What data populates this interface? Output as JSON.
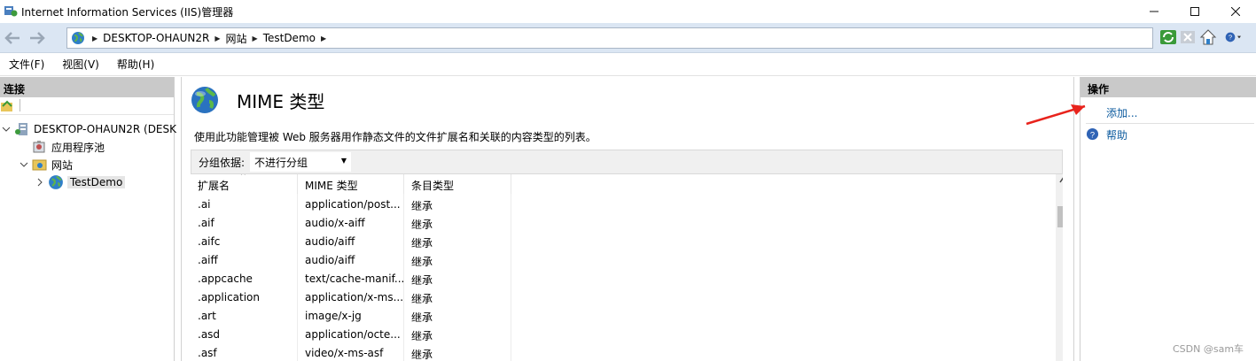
{
  "window": {
    "title": "Internet Information Services (IIS)管理器"
  },
  "address": {
    "crumbs": [
      "DESKTOP-OHAUN2R",
      "网站",
      "TestDemo"
    ]
  },
  "menu": [
    "文件(F)",
    "视图(V)",
    "帮助(H)"
  ],
  "connections": {
    "header": "连接",
    "tree": [
      {
        "label": "DESKTOP-OHAUN2R (DESK",
        "icon": "server-icon"
      },
      {
        "label": "应用程序池",
        "icon": "app-pool-icon"
      },
      {
        "label": "网站",
        "icon": "sites-folder-icon"
      },
      {
        "label": "TestDemo",
        "icon": "globe-icon",
        "selected": true
      }
    ]
  },
  "main": {
    "title": "MIME 类型",
    "description": "使用此功能管理被 Web 服务器用作静态文件的文件扩展名和关联的内容类型的列表。",
    "group_label": "分组依据:",
    "group_value": "不进行分组",
    "columns": [
      "扩展名",
      "MIME 类型",
      "条目类型"
    ],
    "rows": [
      [
        ".ai",
        "application/post...",
        "继承"
      ],
      [
        ".aif",
        "audio/x-aiff",
        "继承"
      ],
      [
        ".aifc",
        "audio/aiff",
        "继承"
      ],
      [
        ".aiff",
        "audio/aiff",
        "继承"
      ],
      [
        ".appcache",
        "text/cache-manif...",
        "继承"
      ],
      [
        ".application",
        "application/x-ms...",
        "继承"
      ],
      [
        ".art",
        "image/x-jg",
        "继承"
      ],
      [
        ".asd",
        "application/octe...",
        "继承"
      ],
      [
        ".asf",
        "video/x-ms-asf",
        "继承"
      ]
    ]
  },
  "actions": {
    "header": "操作",
    "add": "添加...",
    "help": "帮助"
  },
  "watermark": "CSDN @sam车"
}
